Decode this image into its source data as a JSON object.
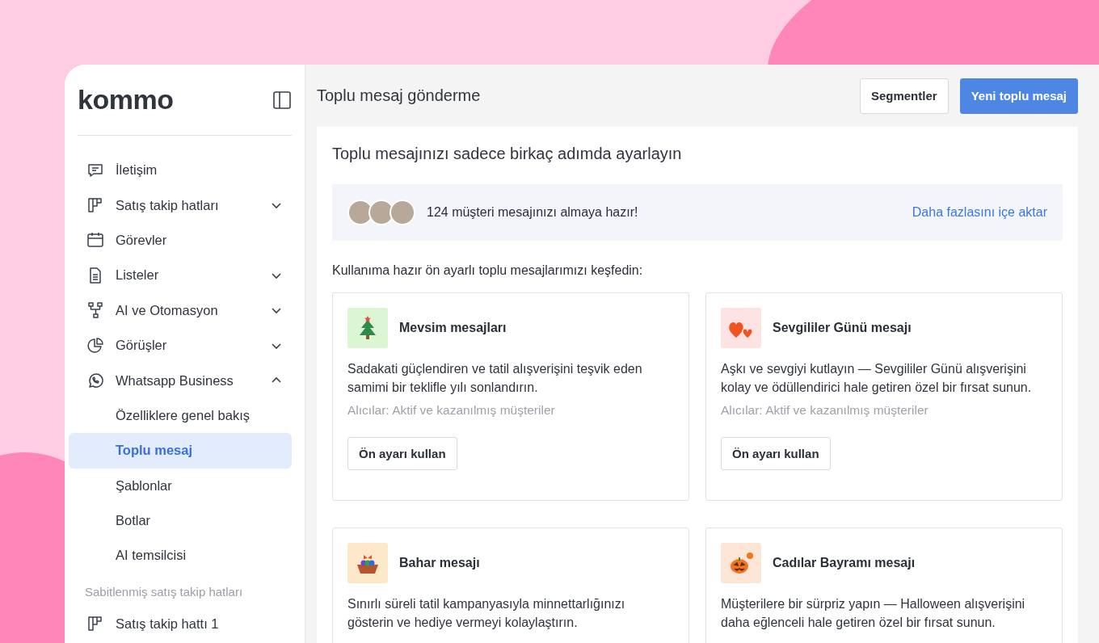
{
  "logo": "kommo",
  "sidebar": {
    "items": [
      {
        "label": "İletişim",
        "selected": false
      },
      {
        "label": "Satış takip hatları",
        "selected": false,
        "expanded": false
      },
      {
        "label": "Görevler",
        "selected": false
      },
      {
        "label": "Listeler",
        "selected": false,
        "expanded": false
      },
      {
        "label": "AI ve Otomasyon",
        "selected": false,
        "expanded": false
      },
      {
        "label": "Görüşler",
        "selected": false,
        "expanded": false
      },
      {
        "label": "Whatsapp Business",
        "selected": false,
        "expanded": true,
        "children": [
          {
            "label": "Özelliklere genel bakış",
            "selected": false
          },
          {
            "label": "Toplu mesaj",
            "selected": true
          },
          {
            "label": "Şablonlar",
            "selected": false
          },
          {
            "label": "Botlar",
            "selected": false
          },
          {
            "label": "AI temsilcisi",
            "selected": false
          }
        ]
      }
    ],
    "pinned_title": "Sabitlenmiş satış takip hatları",
    "pinned_items": [
      {
        "label": "Satış takip hattı 1",
        "selected": false
      }
    ]
  },
  "main": {
    "title": "Toplu mesaj gönderme",
    "buttons": [
      {
        "label": "Segmentler",
        "kind": "secondary"
      },
      {
        "label": "Yeni toplu mesaj",
        "kind": "primary"
      }
    ],
    "setup_title": "Toplu mesajınızı sadece birkaç adımda ayarlayın",
    "audience_text": "124 müşteri mesajınızı almaya hazır!",
    "audience_link": "Daha fazlasını içe aktar",
    "presets_heading": "Kullanıma hazır ön ayarlı toplu mesajlarımızı keşfedin:",
    "presets": [
      {
        "title": "Mevsim mesajları",
        "description": "Sadakati güçlendiren ve tatil alışverişini teşvik eden samimi bir teklifle yılı sonlandırın.",
        "recipients": "Alıcılar: Aktif ve kazanılmış müşteriler",
        "button": "Ön ayarı kullan"
      },
      {
        "title": "Sevgililer Günü mesajı",
        "description": "Aşkı ve sevgiyi kutlayın — Sevgililer Günü alışverişini kolay ve ödüllendirici hale getiren özel bir fırsat sunun.",
        "recipients": "Alıcılar: Aktif ve kazanılmış müşteriler",
        "button": "Ön ayarı kullan"
      },
      {
        "title": "Bahar mesajı",
        "description": "Sınırlı süreli tatil kampanyasıyla minnettarlığınızı gösterin ve hediye vermeyi kolaylaştırın."
      },
      {
        "title": "Cadılar Bayramı mesajı",
        "description": "Müşterilere bir sürpriz yapın — Halloween alışverişini daha eğlenceli hale getiren özel bir fırsat sunun."
      }
    ]
  }
}
